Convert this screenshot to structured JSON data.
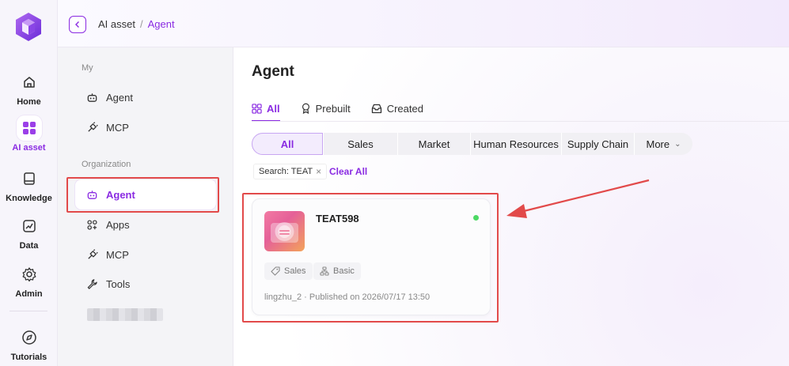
{
  "rail": {
    "items": [
      {
        "label": "Home",
        "icon": "home-icon"
      },
      {
        "label": "AI asset",
        "icon": "grid-icon"
      },
      {
        "label": "Knowledge",
        "icon": "book-icon"
      },
      {
        "label": "Data",
        "icon": "chart-icon"
      },
      {
        "label": "Admin",
        "icon": "gear-icon"
      },
      {
        "label": "Tutorials",
        "icon": "compass-icon"
      }
    ],
    "active": "AI asset"
  },
  "header": {
    "breadcrumb": [
      "AI asset",
      "Agent"
    ],
    "separator": "/"
  },
  "sidebar": {
    "groups": [
      {
        "title": "My",
        "items": [
          {
            "label": "Agent",
            "icon": "robot-icon"
          },
          {
            "label": "MCP",
            "icon": "plug-icon"
          }
        ]
      },
      {
        "title": "Organization",
        "items": [
          {
            "label": "Agent",
            "icon": "robot-icon"
          },
          {
            "label": "Apps",
            "icon": "apps-icon"
          },
          {
            "label": "MCP",
            "icon": "plug-icon"
          },
          {
            "label": "Tools",
            "icon": "wrench-icon"
          }
        ]
      }
    ],
    "active": "Organization/Agent"
  },
  "main": {
    "title": "Agent",
    "tabs": [
      {
        "label": "All",
        "icon": "grid-small-icon"
      },
      {
        "label": "Prebuilt",
        "icon": "award-icon"
      },
      {
        "label": "Created",
        "icon": "inbox-icon"
      }
    ],
    "active_tab": "All",
    "categories": [
      "All",
      "Sales",
      "Market",
      "Human Resources",
      "Supply Chain",
      "More"
    ],
    "active_category": "All",
    "filter": {
      "chip": "Search: TEAT",
      "clear": "Clear All"
    },
    "card": {
      "title": "TEAT598",
      "status_color": "#4cd964",
      "tags": [
        {
          "label": "Sales",
          "icon": "tag-icon"
        },
        {
          "label": "Basic",
          "icon": "hierarchy-icon"
        }
      ],
      "meta": "lingzhu_2 · Published on 2026/07/17 13:50"
    }
  },
  "colors": {
    "accent": "#8a2be2",
    "highlight": "#e24a4a"
  }
}
